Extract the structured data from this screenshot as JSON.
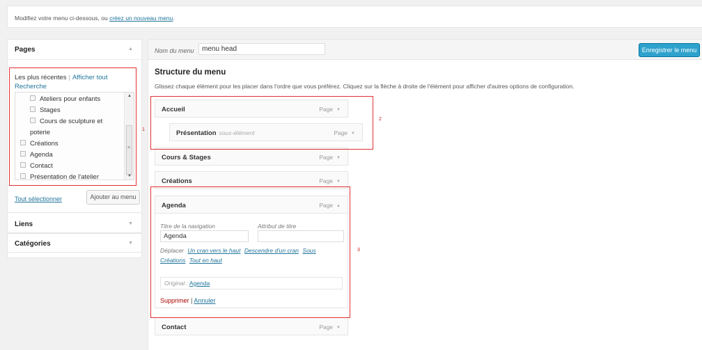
{
  "notice": {
    "text": "Modifiez votre menu ci-dessous, ou ",
    "link": "créez un nouveau menu",
    "suffix": "."
  },
  "pages_box": {
    "title": "Pages",
    "tab_recent": "Les plus récentes",
    "tab_all": "Afficher tout",
    "tab_search": "Recherche",
    "items": [
      {
        "label": "Ateliers pour enfants"
      },
      {
        "label": "Stages"
      },
      {
        "label": "Cours de sculpture et"
      },
      {
        "label": "poterie"
      },
      {
        "label": "Créations"
      },
      {
        "label": "Agenda"
      },
      {
        "label": "Contact"
      },
      {
        "label": "Présentation de l'atelier"
      }
    ],
    "select_all": "Tout sélectionner",
    "add_button": "Ajouter au menu"
  },
  "liens_box": {
    "title": "Liens"
  },
  "categories_box": {
    "title": "Catégories"
  },
  "menu_header": {
    "name_label": "Nom du menu",
    "name_value": "menu head",
    "save_button": "Enregistrer le menu"
  },
  "structure": {
    "title": "Structure du menu",
    "description": "Glissez chaque élément pour les placer dans l'ordre que vous préférez. Cliquez sur la flèche à droite de l'élément pour afficher d'autres options de configuration.",
    "items": [
      {
        "title": "Accueil",
        "type": "Page"
      },
      {
        "title": "Présentation",
        "subtitle": "sous-élément",
        "type": "Page"
      },
      {
        "title": "Cours & Stages",
        "type": "Page"
      },
      {
        "title": "Créations",
        "type": "Page"
      },
      {
        "title": "Agenda",
        "type": "Page"
      },
      {
        "title": "Contact",
        "type": "Page"
      }
    ]
  },
  "agenda_settings": {
    "nav_label": "Titre de la navigation",
    "nav_value": "Agenda",
    "attr_label": "Attribut de titre",
    "attr_value": "",
    "move_label": "Déplacer",
    "move_up": "Un cran vers le haut",
    "move_down": "Descendre d'un cran",
    "move_sub": "Sous",
    "move_sub2": "Créations",
    "move_top": "Tout en haut",
    "original_label": "Original :",
    "original_link": "Agenda",
    "delete": "Supprimer",
    "separator": "|",
    "cancel": "Annuler"
  },
  "annotations": {
    "n1": "1",
    "n2": "2",
    "n3": "3"
  }
}
